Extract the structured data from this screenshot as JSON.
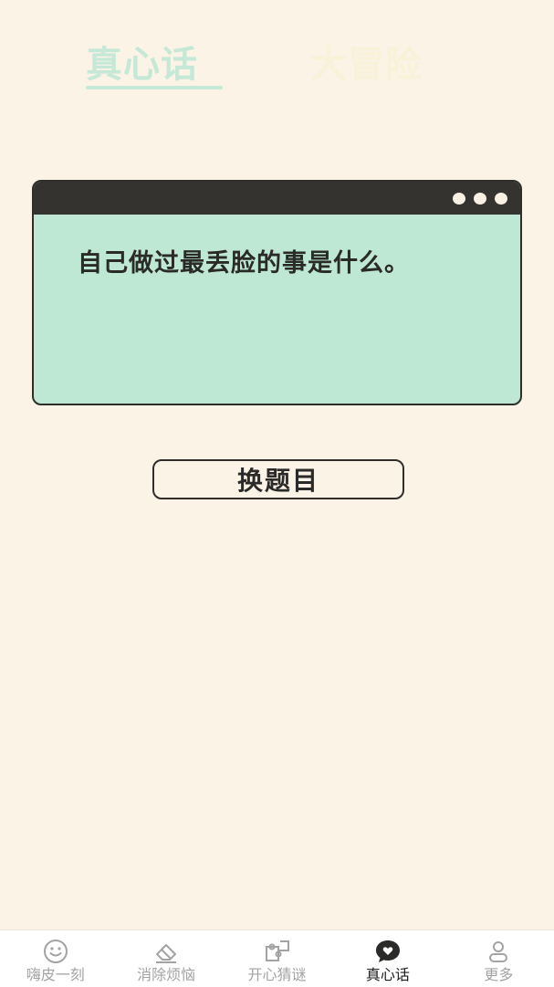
{
  "top_tabs": {
    "truth": "真心话",
    "dare": "大冒险",
    "active": "truth"
  },
  "card": {
    "question": "自己做过最丢脸的事是什么。"
  },
  "change_button": "换题目",
  "bottom_nav": [
    {
      "label": "嗨皮一刻",
      "icon": "smiley-icon"
    },
    {
      "label": "消除烦恼",
      "icon": "eraser-icon"
    },
    {
      "label": "开心猜谜",
      "icon": "puzzle-icon"
    },
    {
      "label": "真心话",
      "icon": "heart-bubble-icon",
      "active": true
    },
    {
      "label": "更多",
      "icon": "user-icon"
    }
  ],
  "colors": {
    "background": "#FAF3E6",
    "card_bg": "#BEE8D4",
    "card_bar": "#34332F",
    "tab_active": "#C6E8D6",
    "tab_inactive": "#FAF1D9",
    "nav_active": "#1C1C1C",
    "nav_inactive": "#A3A3A3"
  }
}
